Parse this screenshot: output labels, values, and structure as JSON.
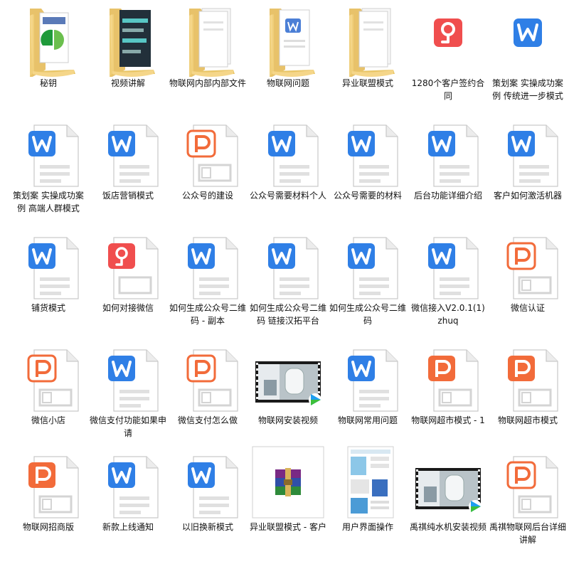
{
  "colors": {
    "word_blue": "#2f7fe6",
    "wps_red": "#f04e4e",
    "ppt_orange": "#f26b3a",
    "folder": "#f5d689",
    "folder_dark": "#e8c26a"
  },
  "items": [
    {
      "label": "秘钥",
      "type": "folder",
      "preview": "pdf"
    },
    {
      "label": "视频讲解",
      "type": "folder",
      "preview": "photo"
    },
    {
      "label": "物联网内部内部文件",
      "type": "folder",
      "preview": "docs"
    },
    {
      "label": "物联网问题",
      "type": "folder",
      "preview": "word"
    },
    {
      "label": "异业联盟模式",
      "type": "folder",
      "preview": "docs"
    },
    {
      "label": "1280个客户签约合同",
      "type": "pdf",
      "icon": "pdf-icon"
    },
    {
      "label": "策划案 实操成功案例 传统进一步模式",
      "type": "word",
      "icon": "word-icon"
    },
    {
      "label": "策划案 实操成功案例 高端人群模式",
      "type": "word_doc",
      "icon": "word-document-icon"
    },
    {
      "label": "饭店营销模式",
      "type": "word_doc",
      "icon": "word-document-icon"
    },
    {
      "label": "公众号的建设",
      "type": "ppt_doc",
      "icon": "presentation-document-icon"
    },
    {
      "label": "公众号需要材料个人",
      "type": "word_doc",
      "icon": "word-document-icon"
    },
    {
      "label": "公众号需要的材料",
      "type": "word_doc",
      "icon": "word-document-icon"
    },
    {
      "label": "后台功能详细介绍",
      "type": "word_doc",
      "icon": "word-document-icon"
    },
    {
      "label": "客户如何激活机器",
      "type": "word_doc",
      "icon": "word-document-icon"
    },
    {
      "label": "铺货模式",
      "type": "word_doc",
      "icon": "word-document-icon"
    },
    {
      "label": "如何对接微信",
      "type": "pdf_doc",
      "icon": "pdf-document-icon"
    },
    {
      "label": "如何生成公众号二维码 - 副本",
      "type": "word_doc",
      "icon": "word-document-icon"
    },
    {
      "label": "如何生成公众号二维码 链接汉拓平台",
      "type": "word_doc",
      "icon": "word-document-icon"
    },
    {
      "label": "如何生成公众号二维码",
      "type": "word_doc",
      "icon": "word-document-icon"
    },
    {
      "label": "微信接入V2.0.1(1)    zhuq",
      "type": "word_doc",
      "icon": "word-document-icon"
    },
    {
      "label": "微信认证",
      "type": "ppt_doc",
      "icon": "presentation-document-icon"
    },
    {
      "label": "微信小店",
      "type": "ppt_doc",
      "icon": "presentation-document-icon"
    },
    {
      "label": "微信支付功能如果申请",
      "type": "word_doc",
      "icon": "word-document-icon"
    },
    {
      "label": "微信支付怎么做",
      "type": "ppt_doc",
      "icon": "presentation-document-icon"
    },
    {
      "label": "物联网安装视频",
      "type": "video",
      "icon": "video-thumbnail-icon"
    },
    {
      "label": "物联网常用问题",
      "type": "word_doc",
      "icon": "word-document-icon"
    },
    {
      "label": "物联网超市模式 - 1",
      "type": "ppt_solid",
      "icon": "presentation-document-icon"
    },
    {
      "label": "物联网超市模式",
      "type": "ppt_solid",
      "icon": "presentation-document-icon"
    },
    {
      "label": "物联网招商版",
      "type": "ppt_solid",
      "icon": "presentation-document-icon"
    },
    {
      "label": "新款上线通知",
      "type": "word_doc",
      "icon": "word-document-icon"
    },
    {
      "label": "以旧换新模式",
      "type": "word_doc",
      "icon": "word-document-icon"
    },
    {
      "label": "异业联盟模式 - 客户",
      "type": "rar",
      "icon": "archive-icon"
    },
    {
      "label": "用户界面操作",
      "type": "screenshot",
      "icon": "image-thumbnail-icon"
    },
    {
      "label": "禹祺纯水机安装视频",
      "type": "video",
      "icon": "video-thumbnail-icon"
    },
    {
      "label": "禹祺物联网后台详细讲解",
      "type": "ppt_doc",
      "icon": "presentation-document-icon"
    }
  ]
}
